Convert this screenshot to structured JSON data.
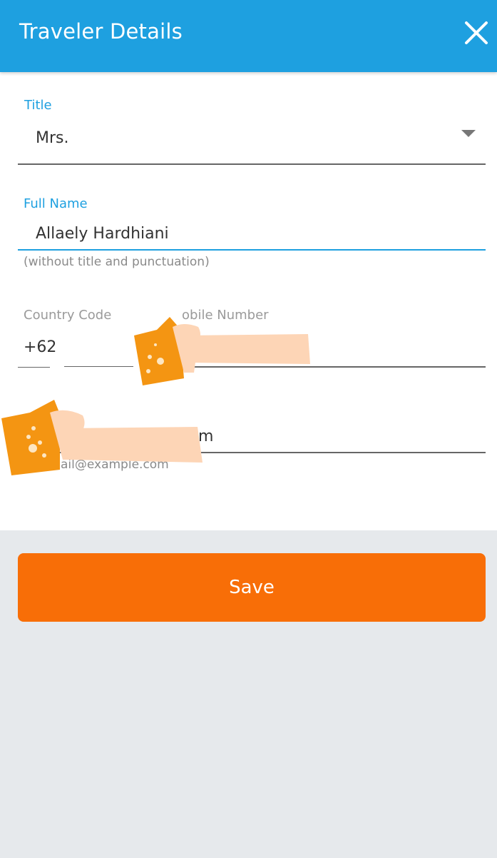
{
  "header": {
    "title": "Traveler Details",
    "close_icon": "close-icon",
    "background_color": "#1ea0e0"
  },
  "form": {
    "title_field": {
      "label": "Title",
      "value": "Mrs.",
      "arrow_icon": "dropdown-arrow-icon"
    },
    "full_name_field": {
      "label": "Full Name",
      "value": "Allaely Hardhiani",
      "helper": "(without title and punctuation)"
    },
    "country_code_field": {
      "label": "Country Code",
      "value": "+62"
    },
    "mobile_number_field": {
      "label": "obile Number",
      "value": ""
    },
    "email_field": {
      "value_visible": "m",
      "helper": "ail@example.com"
    }
  },
  "actions": {
    "save_label": "Save",
    "save_color": "#f86e07"
  },
  "stickers": [
    "beer-mug-icon",
    "beer-mug-icon"
  ]
}
